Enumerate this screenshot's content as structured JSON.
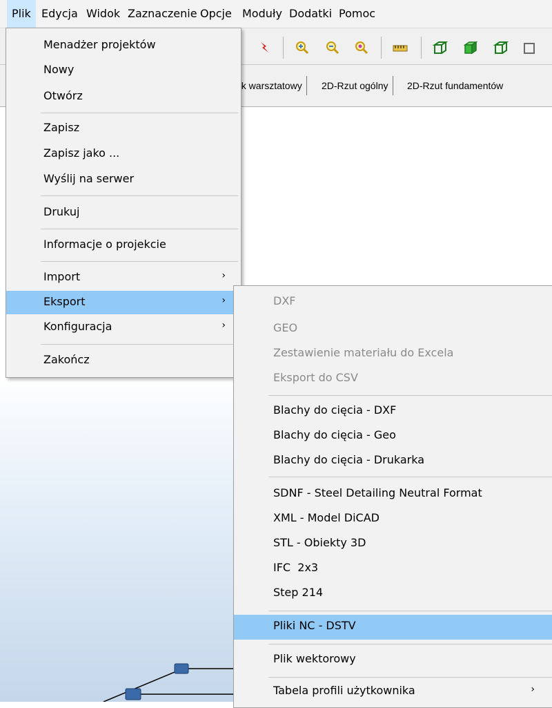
{
  "menubar": {
    "items": [
      "Plik",
      "Edycja",
      "Widok",
      "Zaznaczenie",
      "Opcje",
      "Moduły",
      "Dodatki",
      "Pomoc"
    ]
  },
  "tabs": [
    "ek warsztatowy",
    "2D-Rzut ogólny",
    "2D-Rzut fundamentów"
  ],
  "main_menu": {
    "items": [
      {
        "label": "Menadżer projektów"
      },
      {
        "label": "Nowy"
      },
      {
        "label": "Otwórz"
      },
      {
        "label": "Zapisz"
      },
      {
        "label": "Zapisz jako ..."
      },
      {
        "label": "Wyślij na serwer"
      },
      {
        "label": "Drukuj"
      },
      {
        "label": "Informacje o projekcie"
      },
      {
        "label": "Import",
        "submenu": true
      },
      {
        "label": "Eksport",
        "submenu": true,
        "highlighted": true
      },
      {
        "label": "Konfiguracja",
        "submenu": true
      },
      {
        "label": "Zakończ"
      }
    ]
  },
  "export_menu": {
    "items": [
      {
        "label": "DXF",
        "disabled": true
      },
      {
        "label": "GEO",
        "disabled": true
      },
      {
        "label": "Zestawienie materiału do Excela",
        "disabled": true
      },
      {
        "label": "Eksport do CSV",
        "disabled": true
      },
      {
        "label": "Blachy do cięcia - DXF"
      },
      {
        "label": "Blachy do cięcia - Geo"
      },
      {
        "label": "Blachy do cięcia - Drukarka"
      },
      {
        "label": "SDNF - Steel Detailing Neutral Format"
      },
      {
        "label": "XML - Model DiCAD"
      },
      {
        "label": "STL - Obiekty 3D"
      },
      {
        "label": "IFC  2x3"
      },
      {
        "label": "Step 214"
      },
      {
        "label": "Pliki NC - DSTV",
        "highlighted": true
      },
      {
        "label": "Plik wektorowy"
      },
      {
        "label": "Tabela profili użytkownika",
        "submenu": true
      }
    ]
  },
  "submenu_arrow": "›",
  "colors": {
    "menu_highlight": "#91c9f7",
    "menubar_active": "#cce8ff",
    "node_blue": "#3a6aa8"
  }
}
